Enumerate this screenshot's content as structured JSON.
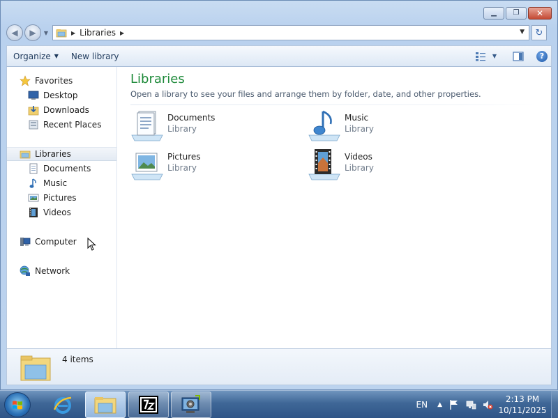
{
  "window": {
    "caption": {
      "minimize_glyph": "▁",
      "maximize_glyph": "❐",
      "close_glyph": "✕"
    }
  },
  "address": {
    "crumb": "Libraries",
    "separator_glyph": "▶",
    "dropdown_glyph": "▼",
    "back_glyph": "◀",
    "forward_glyph": "▶",
    "refresh_glyph": "↻"
  },
  "toolbar": {
    "organize_label": "Organize",
    "organize_caret": "▼",
    "new_library_label": "New library",
    "view_caret": "▼",
    "help_glyph": "?"
  },
  "navigation": {
    "favorites": {
      "label": "Favorites",
      "icon": "star-icon"
    },
    "favorites_items": [
      {
        "label": "Desktop",
        "icon": "desktop-icon"
      },
      {
        "label": "Downloads",
        "icon": "downloads-icon"
      },
      {
        "label": "Recent Places",
        "icon": "recent-places-icon"
      }
    ],
    "libraries": {
      "label": "Libraries",
      "icon": "libraries-icon"
    },
    "libraries_items": [
      {
        "label": "Documents",
        "icon": "documents-icon"
      },
      {
        "label": "Music",
        "icon": "music-icon"
      },
      {
        "label": "Pictures",
        "icon": "pictures-icon"
      },
      {
        "label": "Videos",
        "icon": "videos-icon"
      }
    ],
    "computer": {
      "label": "Computer",
      "icon": "computer-icon"
    },
    "network": {
      "label": "Network",
      "icon": "network-icon"
    }
  },
  "content": {
    "title": "Libraries",
    "subtitle": "Open a library to see your files and arrange them by folder, date, and other properties.",
    "libraries": [
      {
        "name": "Documents",
        "type": "Library",
        "icon": "documents-library-icon"
      },
      {
        "name": "Music",
        "type": "Library",
        "icon": "music-library-icon"
      },
      {
        "name": "Pictures",
        "type": "Library",
        "icon": "pictures-library-icon"
      },
      {
        "name": "Videos",
        "type": "Library",
        "icon": "videos-library-icon"
      }
    ]
  },
  "details": {
    "count": "4 items"
  },
  "taskbar": {
    "language": "EN",
    "tray_expand_glyph": "▲",
    "time": "2:13 PM",
    "date": "10/11/2025",
    "apps": [
      "start-orb",
      "internet-explorer",
      "windows-explorer",
      "7-zip",
      "system-tool"
    ]
  },
  "colors": {
    "title_green": "#1e8a3a",
    "taskbar_blue": "#3f6797",
    "selection_bg": "#e3eaf3"
  }
}
